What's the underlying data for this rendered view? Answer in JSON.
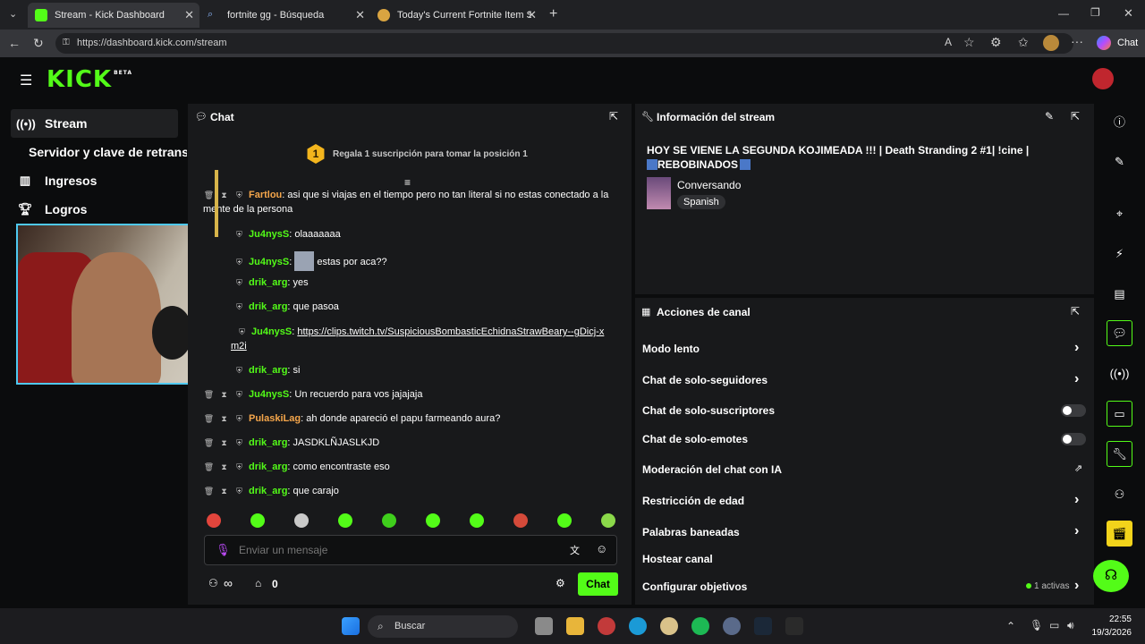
{
  "browser": {
    "tabs": [
      {
        "label": "Stream - Kick Dashboard",
        "active": true
      },
      {
        "label": "fortnite gg - Búsqueda",
        "active": false
      },
      {
        "label": "Today's Current Fortnite Item Shop",
        "active": false
      }
    ],
    "url": "https://dashboard.kick.com/stream",
    "copilot_label": "Chat"
  },
  "app": {
    "logo": "KICK",
    "logo_badge": "BETA",
    "sidebar": [
      {
        "label": "Stream",
        "icon": "broadcast-icon"
      },
      {
        "label": "Servidor y clave de retransmisión",
        "icon": "none"
      },
      {
        "label": "Ingresos",
        "icon": "chart-icon"
      },
      {
        "label": "Logros",
        "icon": "trophy-icon"
      }
    ]
  },
  "chat": {
    "title": "Chat",
    "goal_rank": "1",
    "goal_text": "Regala 1 suscripción para tomar la posición 1",
    "messages": [
      {
        "user": "Fartlou",
        "text": "asi que si viajas en el tiempo pero no tan literal si no estas conectado a la mente de la persona",
        "color": "#f5a64b"
      },
      {
        "user": "Ju4nysS",
        "text": "olaaaaaaa",
        "color": "#53fc18"
      },
      {
        "user": "Ju4nysS",
        "text": "estas por aca??",
        "color": "#53fc18"
      },
      {
        "user": "drik_arg",
        "text": "yes",
        "color": "#53fc18"
      },
      {
        "user": "drik_arg",
        "text": "que pasoa",
        "color": "#53fc18"
      },
      {
        "user": "Ju4nysS",
        "text": "https://clips.twitch.tv/SuspiciousBombasticEchidnaStrawBeary--gDicj-xm2i",
        "color": "#53fc18"
      },
      {
        "user": "drik_arg",
        "text": "si",
        "color": "#53fc18"
      },
      {
        "user": "Ju4nysS",
        "text": "Un recuerdo para vos jajajaja",
        "color": "#53fc18"
      },
      {
        "user": "PulaskiLag",
        "text": "ah donde apareció el papu farmeando aura?",
        "color": "#f5a64b"
      },
      {
        "user": "drik_arg",
        "text": "JASDKLÑJASLKJD",
        "color": "#53fc18"
      },
      {
        "user": "drik_arg",
        "text": "como encontraste eso",
        "color": "#53fc18"
      },
      {
        "user": "drik_arg",
        "text": "que carajo",
        "color": "#53fc18"
      }
    ],
    "input_placeholder": "Enviar un mensaje",
    "viewer_count_symbol": "∞",
    "store_count": "0",
    "send_label": "Chat"
  },
  "stream_info": {
    "title": "Información del stream",
    "stream_title_line1": "HOY SE VIENE LA SEGUNDA KOJIMEADA !!! | Death Stranding 2 #1| !cine |",
    "stream_title_line2": "REBOBINADOS",
    "category": "Conversando",
    "language": "Spanish"
  },
  "channel_actions": {
    "title": "Acciones de canal",
    "items": [
      {
        "label": "Modo lento",
        "control": "chevron"
      },
      {
        "label": "Chat de solo-seguidores",
        "control": "chevron"
      },
      {
        "label": "Chat de solo-suscriptores",
        "control": "toggle"
      },
      {
        "label": "Chat de solo-emotes",
        "control": "toggle"
      },
      {
        "label": "Moderación del chat con IA",
        "control": "external"
      },
      {
        "label": "Restricción de edad",
        "control": "chevron"
      },
      {
        "label": "Palabras baneadas",
        "control": "chevron"
      },
      {
        "label": "Hostear canal",
        "control": "none"
      },
      {
        "label": "Configurar objetivos",
        "control": "chevron"
      }
    ],
    "goals_status": "1 activas"
  },
  "taskbar": {
    "search_label": "Buscar",
    "time": "22:55",
    "date": "19/3/2026"
  },
  "colors": {
    "accent": "#53fc18",
    "panel": "#18191b",
    "background": "#0b0c0d"
  }
}
